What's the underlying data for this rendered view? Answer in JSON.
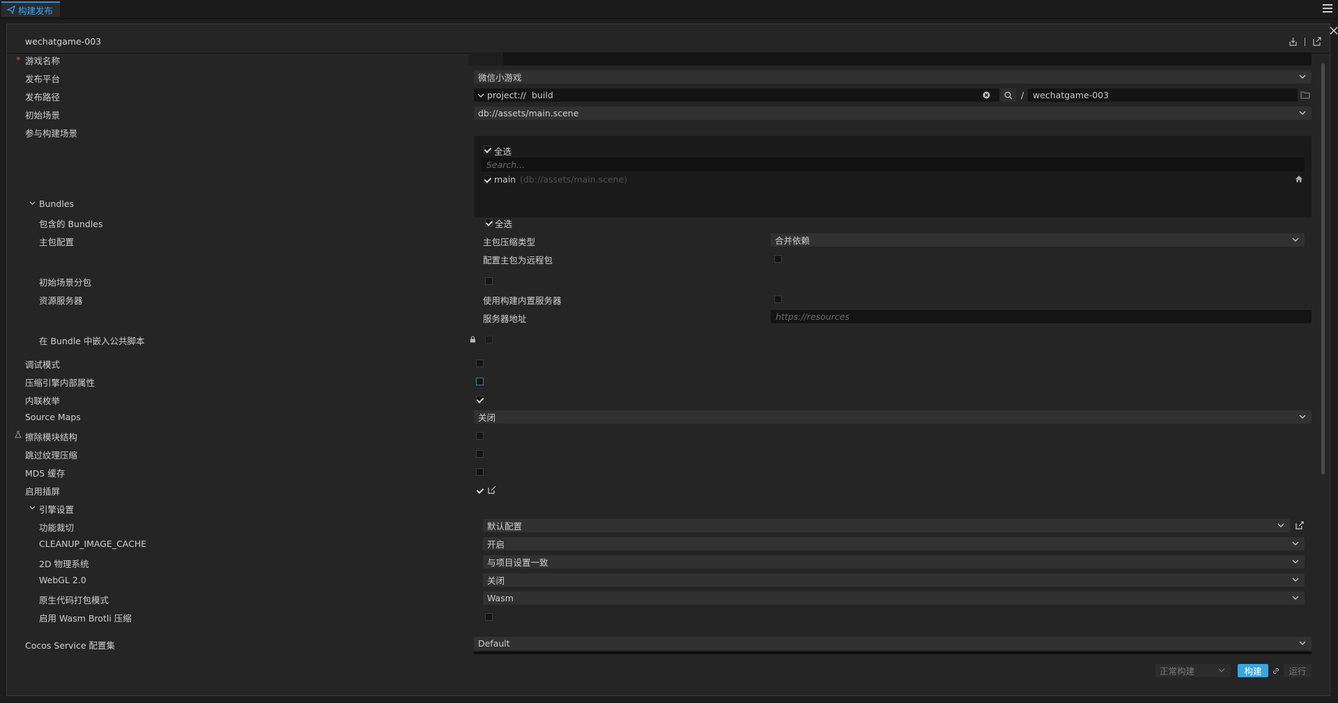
{
  "window": {
    "tab_label": "构建发布",
    "panel_title": "wechatgame-003"
  },
  "fields": {
    "game_name": {
      "label": "游戏名称",
      "value": ""
    },
    "platform": {
      "label": "发布平台",
      "value": "微信小游戏"
    },
    "build_path": {
      "label": "发布路径",
      "protocol": "project://",
      "path": "build",
      "separator": "/",
      "folder": "wechatgame-003"
    },
    "start_scene": {
      "label": "初始场景",
      "value": "db://assets/main.scene"
    },
    "scenes": {
      "label": "参与构建场景",
      "select_all": "全选",
      "search_placeholder": "Search...",
      "items": [
        {
          "name": "main",
          "path": "(db://assets/main.scene)"
        }
      ]
    }
  },
  "bundles": {
    "label": "Bundles",
    "included": {
      "label": "包含的 Bundles",
      "select_all": "全选"
    },
    "main_pkg": {
      "label": "主包配置",
      "compress_type_label": "主包压缩类型",
      "compress_type_value": "合并依赖",
      "remote_label": "配置主包为远程包"
    },
    "start_scene_sub": {
      "label": "初始场景分包"
    },
    "resource_server": {
      "label": "资源服务器",
      "builtin_label": "使用构建内置服务器",
      "address_label": "服务器地址",
      "address_placeholder": "https://resources"
    },
    "embed_script": {
      "label": "在 Bundle 中嵌入公共脚本"
    }
  },
  "options": {
    "debug": "调试模式",
    "mangle": "压缩引擎内部属性",
    "inline_enum": "内联枚举",
    "source_maps": {
      "label": "Source Maps",
      "value": "关闭"
    },
    "erase_module": "擦除模块结构",
    "skip_texture": "跳过纹理压缩",
    "md5": "MD5 缓存",
    "splash": "启用插屏"
  },
  "engine": {
    "label": "引擎设置",
    "feature_cut": {
      "label": "功能裁切",
      "value": "默认配置"
    },
    "cleanup_cache": {
      "label": "CLEANUP_IMAGE_CACHE",
      "value": "开启"
    },
    "physics_2d": {
      "label": "2D 物理系统",
      "value": "与项目设置一致"
    },
    "webgl2": {
      "label": "WebGL 2.0",
      "value": "关闭"
    },
    "native_code": {
      "label": "原生代码打包模式",
      "value": "Wasm"
    },
    "wasm_brotli": {
      "label": "启用 Wasm Brotli 压缩"
    }
  },
  "service": {
    "label": "Cocos Service 配置集",
    "value": "Default"
  },
  "footer": {
    "mode_value": "正常构建",
    "build_label": "构建",
    "run_label": "运行"
  },
  "colors": {
    "accent": "#2d8fd8",
    "build_button": "#39a6e0",
    "panel_bg": "#252525",
    "input_bg": "#141414"
  }
}
